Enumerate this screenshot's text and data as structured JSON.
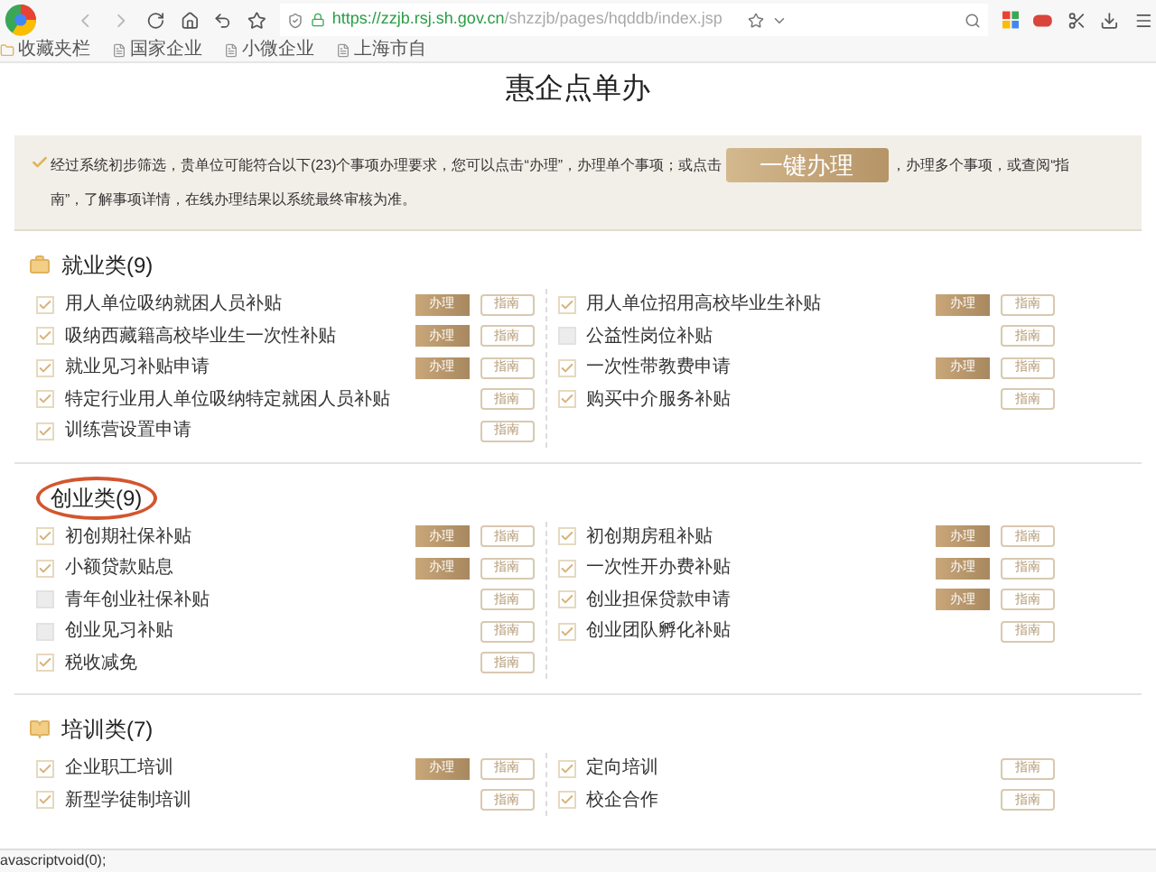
{
  "browser": {
    "url_host": "https://zzjb.rsj.sh.gov.cn",
    "url_path": "/shzzjb/pages/hqddb/index.jsp",
    "bookmarks": [
      "收藏夹栏",
      "国家企业",
      "小微企业",
      "上海市自"
    ]
  },
  "page": {
    "title": "惠企点单办",
    "notice": {
      "before": "经过系统初步筛选，贵单位可能符合以下(23)个事项办理要求，您可以点击“办理”，办理单个事项；或点击",
      "button": "一键办理",
      "after": "，办理多个事项，或查阅“指",
      "continuation": "南”，了解事项详情，在线办理结果以系统最终审核为准。"
    },
    "sections": [
      {
        "title": "就业类(9)",
        "circled": false,
        "columns": [
          [
            {
              "label": "用人单位吸纳就困人员补贴",
              "checked": true,
              "apply": "办理",
              "guide": "指南"
            },
            {
              "label": "吸纳西藏籍高校毕业生一次性补贴",
              "checked": true,
              "apply": "办理",
              "guide": "指南"
            },
            {
              "label": "就业见习补贴申请",
              "checked": true,
              "apply": "办理",
              "guide": "指南"
            },
            {
              "label": "特定行业用人单位吸纳特定就困人员补贴",
              "checked": true,
              "guide": "指南"
            },
            {
              "label": "训练营设置申请",
              "checked": true,
              "guide": "指南"
            }
          ],
          [
            {
              "label": "用人单位招用高校毕业生补贴",
              "checked": true,
              "apply": "办理",
              "guide": "指南"
            },
            {
              "label": "公益性岗位补贴",
              "checked": false,
              "guide": "指南"
            },
            {
              "label": "一次性带教费申请",
              "checked": true,
              "apply": "办理",
              "guide": "指南"
            },
            {
              "label": "购买中介服务补贴",
              "checked": true,
              "guide": "指南"
            }
          ]
        ]
      },
      {
        "title": "创业类(9)",
        "circled": true,
        "columns": [
          [
            {
              "label": "初创期社保补贴",
              "checked": true,
              "apply": "办理",
              "guide": "指南"
            },
            {
              "label": "小额贷款贴息",
              "checked": true,
              "apply": "办理",
              "guide": "指南"
            },
            {
              "label": "青年创业社保补贴",
              "checked": false,
              "guide": "指南"
            },
            {
              "label": "创业见习补贴",
              "checked": false,
              "guide": "指南"
            },
            {
              "label": "税收减免",
              "checked": true,
              "guide": "指南"
            }
          ],
          [
            {
              "label": "初创期房租补贴",
              "checked": true,
              "apply": "办理",
              "guide": "指南"
            },
            {
              "label": "一次性开办费补贴",
              "checked": true,
              "apply": "办理",
              "guide": "指南"
            },
            {
              "label": "创业担保贷款申请",
              "checked": true,
              "apply": "办理",
              "guide": "指南"
            },
            {
              "label": "创业团队孵化补贴",
              "checked": true,
              "guide": "指南"
            }
          ]
        ]
      },
      {
        "title": "培训类(7)",
        "circled": false,
        "columns": [
          [
            {
              "label": "企业职工培训",
              "checked": true,
              "apply": "办理",
              "guide": "指南"
            },
            {
              "label": "新型学徒制培训",
              "checked": true,
              "guide": "指南"
            }
          ],
          [
            {
              "label": "定向培训",
              "checked": true,
              "guide": "指南"
            },
            {
              "label": "校企合作",
              "checked": true,
              "guide": "指南"
            }
          ]
        ]
      }
    ]
  },
  "status_bar": "avascriptvoid(0);"
}
